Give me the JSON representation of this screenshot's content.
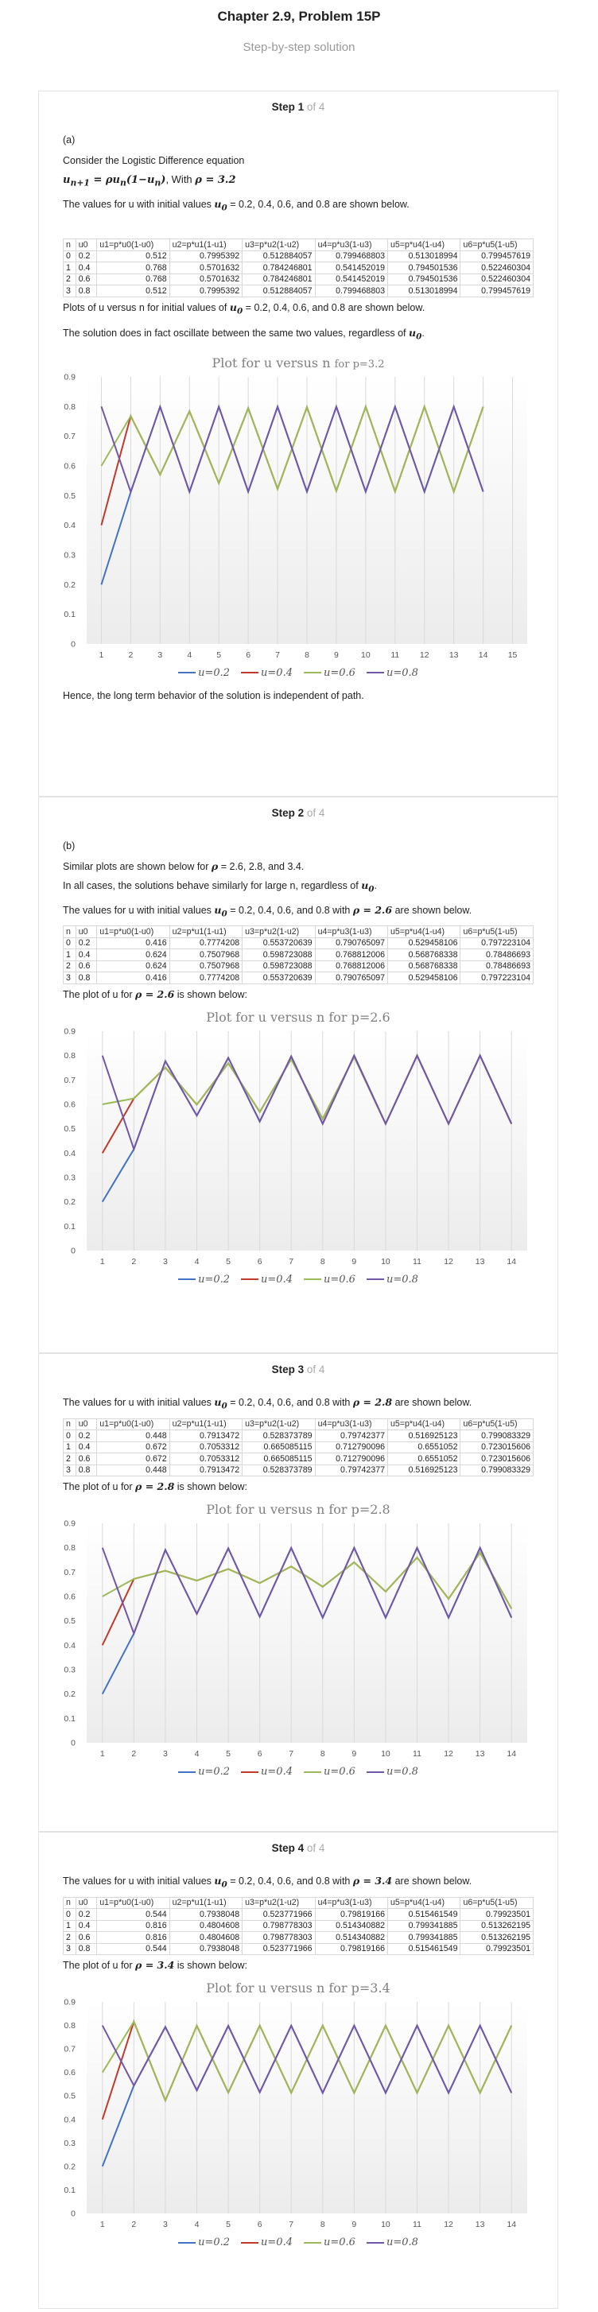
{
  "header": {
    "title": "Chapter 2.9, Problem 15P",
    "subtitle": "Step-by-step solution"
  },
  "colors": {
    "u0_2": "#4472c4",
    "u0_4": "#c0392b",
    "u0_6": "#9bbb59",
    "u0_8": "#7256a8",
    "grid": "#d9d9d9",
    "axis_text": "#555555"
  },
  "columns": [
    "n",
    "u0",
    "u1=p*u0(1-u0)",
    "u2=p*u1(1-u1)",
    "u3=p*u2(1-u2)",
    "u4=p*u3(1-u3)",
    "u5=p*u4(1-u4)",
    "u6=p*u5(1-u5)"
  ],
  "steps": [
    {
      "label": "Step 1",
      "of": "of 4",
      "part": "(a)",
      "intro": "Consider the Logistic Difference equation",
      "equation": "u",
      "eq_with": ", With",
      "eq_rho": "ρ = 3.2",
      "values_text_pre": "The values for u with initial values",
      "values_text_mid": "= 0.2, 0.4, 0.6, and 0.8 are shown below.",
      "rows": [
        [
          "0",
          "0.2",
          "0.512",
          "0.7995392",
          "0.512884057",
          "0.799468803",
          "0.513018994",
          "0.799457619"
        ],
        [
          "1",
          "0.4",
          "0.768",
          "0.5701632",
          "0.784246801",
          "0.541452019",
          "0.794501536",
          "0.522460304"
        ],
        [
          "2",
          "0.6",
          "0.768",
          "0.5701632",
          "0.784246801",
          "0.541452019",
          "0.794501536",
          "0.522460304"
        ],
        [
          "3",
          "0.8",
          "0.512",
          "0.7995392",
          "0.512884057",
          "0.799468803",
          "0.513018994",
          "0.799457619"
        ]
      ],
      "plot_text": "Plots of u versus n for initial values of",
      "plot_text2": "= 0.2, 0.4, 0.6, and 0.8 are shown below.",
      "oscillate_text": "The solution does in fact oscillate between the same two values, regardless of",
      "conclusion": "Hence, the long term behavior of the solution is independent of path."
    },
    {
      "label": "Step 2",
      "of": "of 4",
      "part": "(b)",
      "intro": "Similar plots are shown below for",
      "intro_rho": "ρ",
      "intro_vals": "= 2.6, 2.8, and 3.4.",
      "intro2": "In all cases, the solutions behave similarly for large n, regardless of",
      "values_text_pre": "The values for u with initial values",
      "values_text_mid": "= 0.2, 0.4, 0.6, and 0.8 with",
      "values_rho": "ρ = 2.6",
      "values_tail": "are shown below.",
      "rows": [
        [
          "0",
          "0.2",
          "0.416",
          "0.7774208",
          "0.553720639",
          "0.790765097",
          "0.529458106",
          "0.797223104"
        ],
        [
          "1",
          "0.4",
          "0.624",
          "0.7507968",
          "0.598723088",
          "0.768812006",
          "0.568768338",
          "0.78486693"
        ],
        [
          "2",
          "0.6",
          "0.624",
          "0.7507968",
          "0.598723088",
          "0.768812006",
          "0.568768338",
          "0.78486693"
        ],
        [
          "3",
          "0.8",
          "0.416",
          "0.7774208",
          "0.553720639",
          "0.790765097",
          "0.529458106",
          "0.797223104"
        ]
      ],
      "plot_pre": "The plot of u for",
      "plot_rho": "ρ = 2.6",
      "plot_post": "is shown below:"
    },
    {
      "label": "Step 3",
      "of": "of 4",
      "values_text_pre": "The values for u with initial values",
      "values_text_mid": "= 0.2, 0.4, 0.6, and 0.8 with",
      "values_rho": "ρ = 2.8",
      "values_tail": "are shown below.",
      "rows": [
        [
          "0",
          "0.2",
          "0.448",
          "0.7913472",
          "0.528373789",
          "0.79742377",
          "0.516925123",
          "0.799083329"
        ],
        [
          "1",
          "0.4",
          "0.672",
          "0.7053312",
          "0.665085115",
          "0.712790096",
          "0.6551052",
          "0.723015606"
        ],
        [
          "2",
          "0.6",
          "0.672",
          "0.7053312",
          "0.665085115",
          "0.712790096",
          "0.6551052",
          "0.723015606"
        ],
        [
          "3",
          "0.8",
          "0.448",
          "0.7913472",
          "0.528373789",
          "0.79742377",
          "0.516925123",
          "0.799083329"
        ]
      ],
      "plot_pre": "The plot of u for",
      "plot_rho": "ρ = 2.8",
      "plot_post": "is shown below:"
    },
    {
      "label": "Step 4",
      "of": "of 4",
      "values_text_pre": "The values for u with initial values",
      "values_text_mid": "= 0.2, 0.4, 0.6, and 0.8 with",
      "values_rho": "ρ = 3.4",
      "values_tail": "are shown below.",
      "rows": [
        [
          "0",
          "0.2",
          "0.544",
          "0.7938048",
          "0.523771966",
          "0.79819166",
          "0.515461549",
          "0.79923501"
        ],
        [
          "1",
          "0.4",
          "0.816",
          "0.4804608",
          "0.798778303",
          "0.514340882",
          "0.799341885",
          "0.513262195"
        ],
        [
          "2",
          "0.6",
          "0.816",
          "0.4804608",
          "0.798778303",
          "0.514340882",
          "0.799341885",
          "0.513262195"
        ],
        [
          "3",
          "0.8",
          "0.544",
          "0.7938048",
          "0.523771966",
          "0.79819166",
          "0.515461549",
          "0.79923501"
        ]
      ],
      "plot_pre": "The plot of u for",
      "plot_rho": "ρ = 3.4",
      "plot_post": "is shown below:"
    }
  ],
  "chart_data": [
    {
      "type": "line",
      "title": "Plot for u versus n",
      "title_suffix": "for p=3.2",
      "x": [
        1,
        2,
        3,
        4,
        5,
        6,
        7,
        8,
        9,
        10,
        11,
        12,
        13,
        14
      ],
      "xlim": [
        0.5,
        15.5
      ],
      "xticks": [
        1,
        2,
        3,
        4,
        5,
        6,
        7,
        8,
        9,
        10,
        11,
        12,
        13,
        14,
        15
      ],
      "ylim": [
        0,
        0.9
      ],
      "yticks": [
        0,
        0.1,
        0.2,
        0.3,
        0.4,
        0.5,
        0.6,
        0.7,
        0.8,
        0.9
      ],
      "grid": "vertical",
      "legend": "bottom",
      "series": [
        {
          "name": "u=0.2",
          "values": [
            0.2,
            0.512,
            0.7995,
            0.5129,
            0.7995,
            0.513,
            0.7995,
            0.513,
            0.7995,
            0.513,
            0.7995,
            0.513,
            0.7995,
            0.513
          ]
        },
        {
          "name": "u=0.4",
          "values": [
            0.4,
            0.768,
            0.5702,
            0.7842,
            0.5415,
            0.7945,
            0.5225,
            0.7982,
            0.5158,
            0.7993,
            0.5136,
            0.7995,
            0.5131,
            0.7995
          ]
        },
        {
          "name": "u=0.6",
          "values": [
            0.6,
            0.768,
            0.5702,
            0.7842,
            0.5415,
            0.7945,
            0.5225,
            0.7982,
            0.5158,
            0.7993,
            0.5136,
            0.7995,
            0.5131,
            0.7995
          ]
        },
        {
          "name": "u=0.8",
          "values": [
            0.8,
            0.512,
            0.7995,
            0.5129,
            0.7995,
            0.513,
            0.7995,
            0.513,
            0.7995,
            0.513,
            0.7995,
            0.513,
            0.7995,
            0.513
          ]
        }
      ]
    },
    {
      "type": "line",
      "title": "Plot for u versus n for p=2.6",
      "x": [
        1,
        2,
        3,
        4,
        5,
        6,
        7,
        8,
        9,
        10,
        11,
        12,
        13,
        14
      ],
      "xlim": [
        0.5,
        14.5
      ],
      "xticks": [
        1,
        2,
        3,
        4,
        5,
        6,
        7,
        8,
        9,
        10,
        11,
        12,
        13,
        14
      ],
      "ylim": [
        0,
        0.9
      ],
      "yticks": [
        0,
        0.1,
        0.2,
        0.3,
        0.4,
        0.5,
        0.6,
        0.7,
        0.8,
        0.9
      ],
      "grid": "vertical",
      "legend": "bottom",
      "series": [
        {
          "name": "u=0.2",
          "values": [
            0.2,
            0.416,
            0.7774,
            0.5537,
            0.7908,
            0.5295,
            0.7972,
            0.52,
            0.8,
            0.52,
            0.8,
            0.52,
            0.8,
            0.52
          ]
        },
        {
          "name": "u=0.4",
          "values": [
            0.4,
            0.624,
            0.7508,
            0.5987,
            0.7688,
            0.5688,
            0.7849,
            0.54,
            0.795,
            0.52,
            0.8,
            0.52,
            0.8,
            0.52
          ]
        },
        {
          "name": "u=0.6",
          "values": [
            0.6,
            0.624,
            0.7508,
            0.5987,
            0.7688,
            0.5688,
            0.7849,
            0.54,
            0.795,
            0.52,
            0.8,
            0.52,
            0.8,
            0.52
          ]
        },
        {
          "name": "u=0.8",
          "values": [
            0.8,
            0.416,
            0.7774,
            0.5537,
            0.7908,
            0.5295,
            0.7972,
            0.52,
            0.8,
            0.52,
            0.8,
            0.52,
            0.8,
            0.52
          ]
        }
      ]
    },
    {
      "type": "line",
      "title": "Plot for u versus n for p=2.8",
      "x": [
        1,
        2,
        3,
        4,
        5,
        6,
        7,
        8,
        9,
        10,
        11,
        12,
        13,
        14
      ],
      "xlim": [
        0.5,
        14.5
      ],
      "xticks": [
        1,
        2,
        3,
        4,
        5,
        6,
        7,
        8,
        9,
        10,
        11,
        12,
        13,
        14
      ],
      "ylim": [
        0,
        0.9
      ],
      "yticks": [
        0,
        0.1,
        0.2,
        0.3,
        0.4,
        0.5,
        0.6,
        0.7,
        0.8,
        0.9
      ],
      "grid": "vertical",
      "legend": "bottom",
      "series": [
        {
          "name": "u=0.2",
          "values": [
            0.2,
            0.448,
            0.7913,
            0.5284,
            0.7974,
            0.5169,
            0.7991,
            0.513,
            0.7995,
            0.513,
            0.7995,
            0.513,
            0.7995,
            0.513
          ]
        },
        {
          "name": "u=0.4",
          "values": [
            0.4,
            0.672,
            0.7053,
            0.6651,
            0.7128,
            0.6551,
            0.723,
            0.64,
            0.74,
            0.62,
            0.76,
            0.59,
            0.78,
            0.55
          ]
        },
        {
          "name": "u=0.6",
          "values": [
            0.6,
            0.672,
            0.7053,
            0.6651,
            0.7128,
            0.6551,
            0.723,
            0.64,
            0.74,
            0.62,
            0.76,
            0.59,
            0.78,
            0.55
          ]
        },
        {
          "name": "u=0.8",
          "values": [
            0.8,
            0.448,
            0.7913,
            0.5284,
            0.7974,
            0.5169,
            0.7991,
            0.513,
            0.7995,
            0.513,
            0.7995,
            0.513,
            0.7995,
            0.513
          ]
        }
      ]
    },
    {
      "type": "line",
      "title": "Plot for u versus n for p=3.4",
      "x": [
        1,
        2,
        3,
        4,
        5,
        6,
        7,
        8,
        9,
        10,
        11,
        12,
        13,
        14
      ],
      "xlim": [
        0.5,
        14.5
      ],
      "xticks": [
        1,
        2,
        3,
        4,
        5,
        6,
        7,
        8,
        9,
        10,
        11,
        12,
        13,
        14
      ],
      "ylim": [
        0,
        0.9
      ],
      "yticks": [
        0,
        0.1,
        0.2,
        0.3,
        0.4,
        0.5,
        0.6,
        0.7,
        0.8,
        0.9
      ],
      "grid": "vertical",
      "legend": "bottom",
      "series": [
        {
          "name": "u=0.2",
          "values": [
            0.2,
            0.544,
            0.7938,
            0.5238,
            0.7982,
            0.5155,
            0.7992,
            0.513,
            0.7995,
            0.513,
            0.7995,
            0.513,
            0.7995,
            0.513
          ]
        },
        {
          "name": "u=0.4",
          "values": [
            0.4,
            0.816,
            0.4805,
            0.7988,
            0.5143,
            0.7993,
            0.5133,
            0.7995,
            0.513,
            0.7995,
            0.513,
            0.7995,
            0.513,
            0.7995
          ]
        },
        {
          "name": "u=0.6",
          "values": [
            0.6,
            0.816,
            0.4805,
            0.7988,
            0.5143,
            0.7993,
            0.5133,
            0.7995,
            0.513,
            0.7995,
            0.513,
            0.7995,
            0.513,
            0.7995
          ]
        },
        {
          "name": "u=0.8",
          "values": [
            0.8,
            0.544,
            0.7938,
            0.5238,
            0.7982,
            0.5155,
            0.7992,
            0.513,
            0.7995,
            0.513,
            0.7995,
            0.513,
            0.7995,
            0.513
          ]
        }
      ]
    }
  ]
}
